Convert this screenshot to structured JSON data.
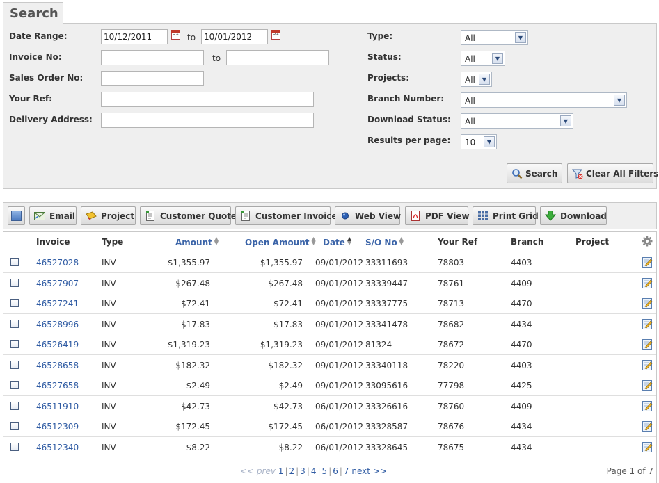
{
  "search": {
    "title": "Search",
    "labels": {
      "date_range": "Date Range:",
      "invoice_no": "Invoice No:",
      "sales_order_no": "Sales Order No:",
      "your_ref": "Your Ref:",
      "delivery_address": "Delivery Address:",
      "type": "Type:",
      "status": "Status:",
      "projects": "Projects:",
      "branch_number": "Branch Number:",
      "download_status": "Download Status:",
      "results_per_page": "Results per page:",
      "to": "to"
    },
    "values": {
      "date_from": "10/12/2011",
      "date_to": "10/01/2012",
      "invoice_from": "",
      "invoice_to": "",
      "sales_order_no": "",
      "your_ref": "",
      "delivery_address": ""
    },
    "selects": {
      "type": "All",
      "status": "All",
      "projects": "All",
      "branch_number": "All",
      "download_status": "All",
      "results_per_page": "10"
    },
    "search_button": "Search",
    "clear_button": "Clear All Filters"
  },
  "toolbar": {
    "buttons": [
      "Email",
      "Project",
      "Customer Quote",
      "Customer Invoice",
      "Web View",
      "PDF View",
      "Print Grid",
      "Download"
    ]
  },
  "grid": {
    "columns": [
      "Invoice",
      "Type",
      "Amount",
      "Open Amount",
      "Date",
      "S/O No",
      "Your Ref",
      "Branch",
      "Project"
    ],
    "rows": [
      {
        "invoice": "46527028",
        "type": "INV",
        "amount": "$1,355.97",
        "open_amount": "$1,355.97",
        "date": "09/01/2012",
        "so_no": "33311693",
        "your_ref": "78803",
        "branch": "4403",
        "project": ""
      },
      {
        "invoice": "46527907",
        "type": "INV",
        "amount": "$267.48",
        "open_amount": "$267.48",
        "date": "09/01/2012",
        "so_no": "33339447",
        "your_ref": "78761",
        "branch": "4409",
        "project": ""
      },
      {
        "invoice": "46527241",
        "type": "INV",
        "amount": "$72.41",
        "open_amount": "$72.41",
        "date": "09/01/2012",
        "so_no": "33337775",
        "your_ref": "78713",
        "branch": "4470",
        "project": ""
      },
      {
        "invoice": "46528996",
        "type": "INV",
        "amount": "$17.83",
        "open_amount": "$17.83",
        "date": "09/01/2012",
        "so_no": "33341478",
        "your_ref": "78682",
        "branch": "4434",
        "project": ""
      },
      {
        "invoice": "46526419",
        "type": "INV",
        "amount": "$1,319.23",
        "open_amount": "$1,319.23",
        "date": "09/01/2012",
        "so_no": "81324",
        "your_ref": "78672",
        "branch": "4470",
        "project": ""
      },
      {
        "invoice": "46528658",
        "type": "INV",
        "amount": "$182.32",
        "open_amount": "$182.32",
        "date": "09/01/2012",
        "so_no": "33340118",
        "your_ref": "78220",
        "branch": "4403",
        "project": ""
      },
      {
        "invoice": "46527658",
        "type": "INV",
        "amount": "$2.49",
        "open_amount": "$2.49",
        "date": "09/01/2012",
        "so_no": "33095616",
        "your_ref": "77798",
        "branch": "4425",
        "project": ""
      },
      {
        "invoice": "46511910",
        "type": "INV",
        "amount": "$42.73",
        "open_amount": "$42.73",
        "date": "06/01/2012",
        "so_no": "33326616",
        "your_ref": "78760",
        "branch": "4409",
        "project": ""
      },
      {
        "invoice": "46512309",
        "type": "INV",
        "amount": "$172.45",
        "open_amount": "$172.45",
        "date": "06/01/2012",
        "so_no": "33328587",
        "your_ref": "78676",
        "branch": "4434",
        "project": ""
      },
      {
        "invoice": "46512340",
        "type": "INV",
        "amount": "$8.22",
        "open_amount": "$8.22",
        "date": "06/01/2012",
        "so_no": "33328645",
        "your_ref": "78675",
        "branch": "4434",
        "project": ""
      }
    ]
  },
  "pagination": {
    "prev": "<< prev",
    "pages": [
      "1",
      "2",
      "3",
      "4",
      "5",
      "6",
      "7"
    ],
    "next": "next >>",
    "page_of": "Page 1 of 7"
  },
  "colors": {
    "link": "#2f5ba3",
    "panel_bg": "#efefef"
  }
}
